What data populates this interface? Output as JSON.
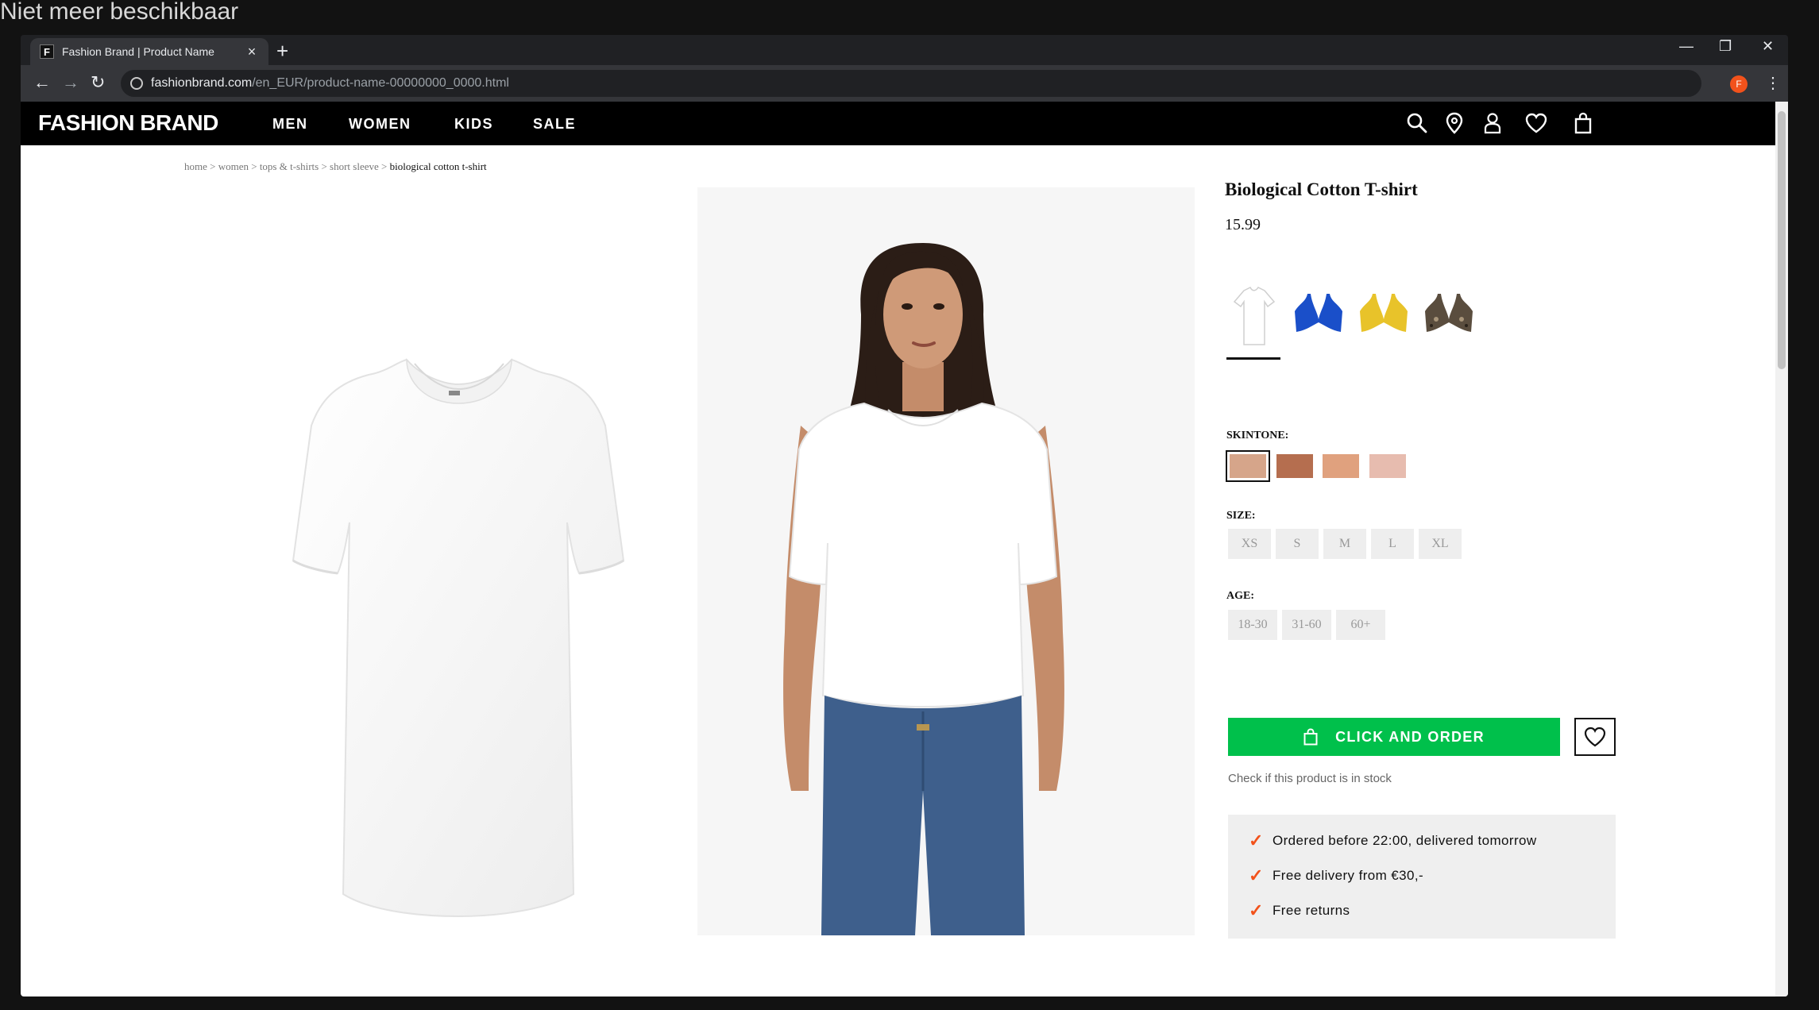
{
  "overlay_text": "Niet meer beschikbaar",
  "browser": {
    "tab_title": "Fashion Brand | Product Name",
    "tab_favicon": "F",
    "tab_close": "×",
    "new_tab": "+",
    "minimize": "—",
    "restore": "❐",
    "close": "✕",
    "back": "←",
    "forward": "→",
    "reload": "↻",
    "url_host": "fashionbrand.com",
    "url_path": "/en_EUR/product-name-00000000_0000.html",
    "profile_initial": "F",
    "menu": "⋮"
  },
  "header": {
    "logo": "FASHION BRAND",
    "nav": [
      "MEN",
      "WOMEN",
      "KIDS",
      "SALE"
    ],
    "icons": [
      "search-icon",
      "location-pin-icon",
      "user-icon",
      "heart-icon",
      "shopping-bag-icon"
    ]
  },
  "breadcrumb": {
    "trail": "home > women > tops & t-shirts > short sleeve > ",
    "current": "biological cotton t-shirt"
  },
  "product": {
    "title": "Biological Cotton T-shirt",
    "price": "15.99",
    "colors": [
      {
        "name": "white-tshirt",
        "color": "#ffffff",
        "selected": true
      },
      {
        "name": "blue-bra",
        "color": "#1a4fc9",
        "selected": false
      },
      {
        "name": "yellow-bra",
        "color": "#e8c32a",
        "selected": false
      },
      {
        "name": "leopard-bra",
        "color": "#5a4d3e",
        "selected": false
      }
    ],
    "skintone_label": "SKINTONE:",
    "skintones": [
      "#d6a58a",
      "#b56e4f",
      "#e0a17e",
      "#e7bcaf"
    ],
    "size_label": "SIZE:",
    "sizes": [
      "XS",
      "S",
      "M",
      "L",
      "XL"
    ],
    "age_label": "AGE:",
    "ages": [
      "18-30",
      "31-60",
      "60+"
    ],
    "order_button": "CLICK AND ORDER",
    "stock_link": "Check if this product is in stock",
    "usps": [
      "Ordered before 22:00, delivered tomorrow",
      "Free delivery from €30,-",
      "Free returns"
    ]
  },
  "colors": {
    "accent_green": "#00c04b",
    "check_orange": "#f2521b",
    "header_black": "#000000"
  }
}
